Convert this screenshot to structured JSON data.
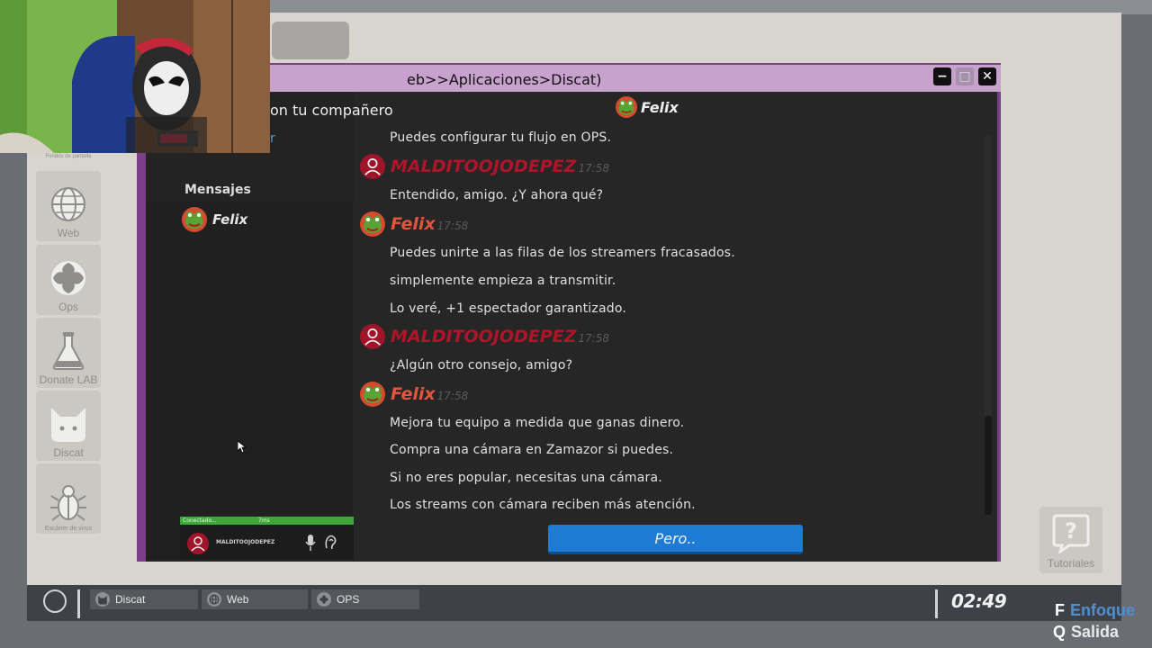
{
  "window": {
    "title_fragment": "eb>>Aplicaciones>Discat)",
    "subheader_fragment": "on tu compañero",
    "subheader_link_fragment": "r"
  },
  "desktop": {
    "top_caption": "Fondos de pantalla",
    "icons": [
      {
        "label": "Web",
        "icon": "globe-icon"
      },
      {
        "label": "Ops",
        "icon": "ops-icon"
      },
      {
        "label": "Donate LAB",
        "icon": "flask-icon"
      },
      {
        "label": "Discat",
        "icon": "cat-icon"
      },
      {
        "label": "Escáner de virus",
        "icon": "bug-icon"
      }
    ],
    "tutorials_label": "Tutoriales"
  },
  "sidebar": {
    "section_title": "Mensajes",
    "contacts": [
      {
        "name": "Felix"
      }
    ],
    "status": {
      "text": "Conectado...",
      "ping": "7ms"
    },
    "current_user": "MALDITOOJODEPEZ"
  },
  "chat": {
    "header_name": "Felix",
    "blocks": [
      {
        "lines": [
          "Puedes configurar tu flujo en OPS."
        ]
      },
      {
        "author": "MALDITOOJODEPEZ",
        "time": "17:58",
        "lines": [
          "Entendido, amigo. ¿Y ahora qué?"
        ]
      },
      {
        "author": "Felix",
        "time": "17:58",
        "lines": [
          "Puedes unirte a las filas de los streamers fracasados.",
          "simplemente empieza a transmitir.",
          "Lo veré, +1 espectador garantizado."
        ]
      },
      {
        "author": "MALDITOOJODEPEZ",
        "time": "17:58",
        "lines": [
          "¿Algún otro consejo, amigo?"
        ]
      },
      {
        "author": "Felix",
        "time": "17:58",
        "lines": [
          "Mejora tu equipo a medida que ganas dinero.",
          "Compra una cámara en Zamazor si puedes.",
          "Si no eres popular, necesitas una cámara.",
          "Los streams con cámara reciben más atención."
        ]
      }
    ],
    "reply_option": "Pero.."
  },
  "taskbar": {
    "items": [
      {
        "label": "Discat",
        "icon": "cat-icon"
      },
      {
        "label": "Web",
        "icon": "globe-icon"
      },
      {
        "label": "OPS",
        "icon": "ops-icon"
      }
    ],
    "clock": "02:49"
  },
  "hints": {
    "focus": {
      "key": "F",
      "action": "Enfoque"
    },
    "exit": {
      "key": "Q",
      "action": "Salida"
    }
  },
  "colors": {
    "window_frame": "#7b3f88",
    "user_name": "#b01428",
    "bot_name": "#e4543c",
    "reply_button": "#1e7ad2",
    "status_green": "#3fa63a"
  }
}
